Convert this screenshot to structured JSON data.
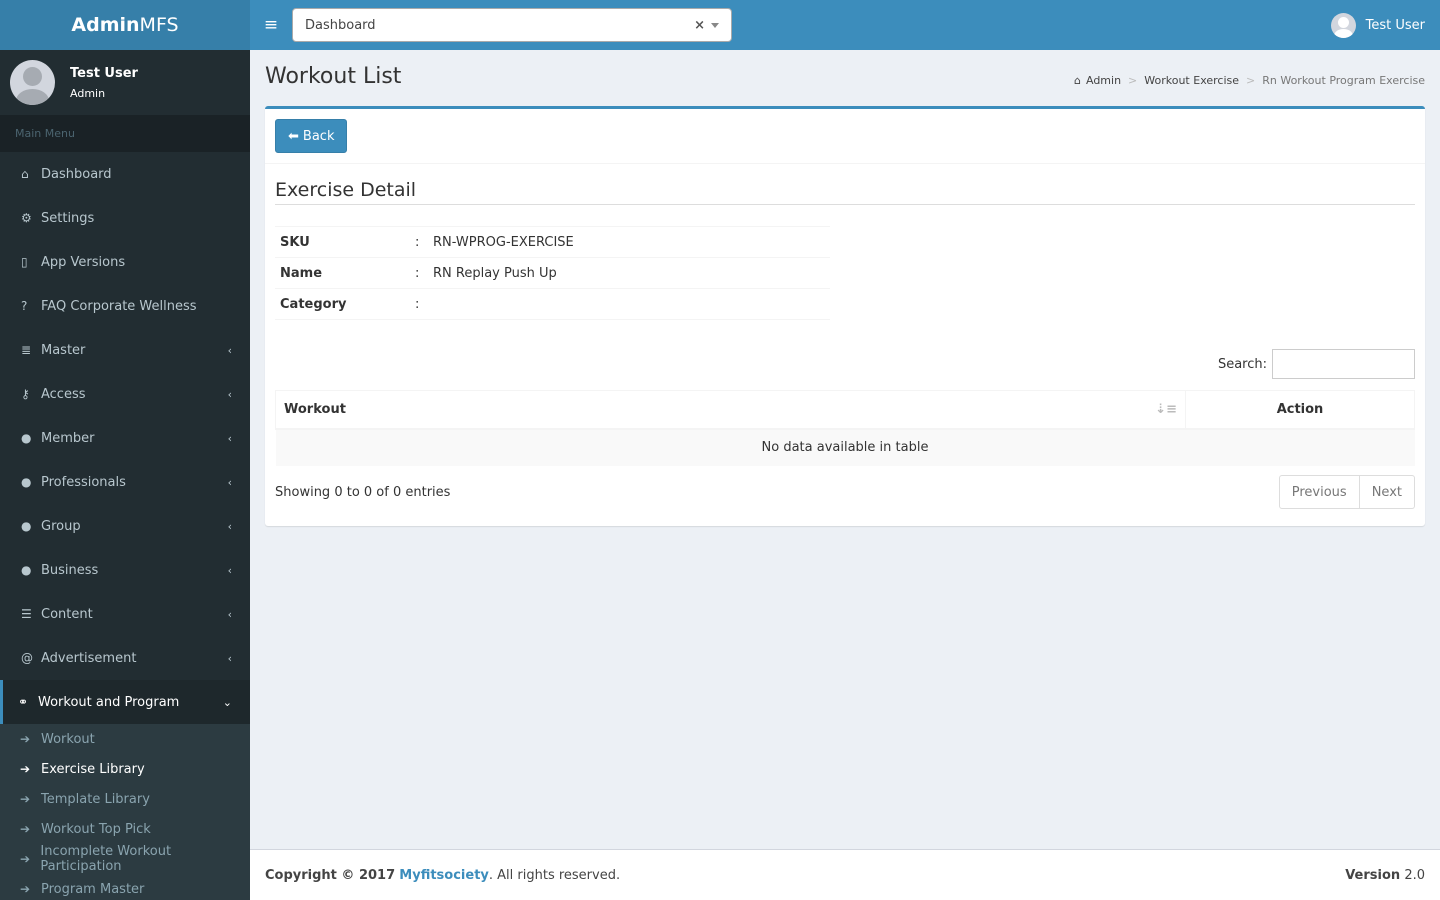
{
  "app": {
    "logo_bold": "Admin",
    "logo_light": "MFS"
  },
  "topbar": {
    "menu_icon": "≡",
    "select_value": "Dashboard",
    "select_clear": "×",
    "user_name": "Test User"
  },
  "sidebar": {
    "user": {
      "name": "Test User",
      "role": "Admin"
    },
    "menu_header": "Main Menu",
    "items": [
      {
        "label": "Dashboard",
        "icon": "home-icon"
      },
      {
        "label": "Settings",
        "icon": "cogs-icon"
      },
      {
        "label": "App Versions",
        "icon": "mobile-icon"
      },
      {
        "label": "FAQ Corporate Wellness",
        "icon": "question-icon"
      },
      {
        "label": "Master",
        "icon": "database-icon"
      },
      {
        "label": "Access",
        "icon": "key-icon"
      },
      {
        "label": "Member",
        "icon": "user-icon"
      },
      {
        "label": "Professionals",
        "icon": "user-icon"
      },
      {
        "label": "Group",
        "icon": "users-icon"
      },
      {
        "label": "Business",
        "icon": "user-icon"
      },
      {
        "label": "Content",
        "icon": "list-icon"
      },
      {
        "label": "Advertisement",
        "icon": "at-icon"
      },
      {
        "label": "Workout and Program",
        "icon": "bicycle-icon"
      }
    ],
    "submenu": [
      {
        "label": "Workout"
      },
      {
        "label": "Exercise Library"
      },
      {
        "label": "Template Library"
      },
      {
        "label": "Workout Top Pick"
      },
      {
        "label": "Incomplete Workout Participation"
      },
      {
        "label": "Program Master"
      }
    ]
  },
  "header": {
    "title": "Workout List",
    "breadcrumb": [
      "Admin",
      "Workout Exercise",
      "Rn Workout Program Exercise"
    ]
  },
  "box": {
    "back_label": "Back",
    "section_title": "Exercise Detail",
    "details": [
      {
        "key": "SKU",
        "value": "RN-WPROG-EXERCISE"
      },
      {
        "key": "Name",
        "value": "RN Replay Push Up"
      },
      {
        "key": "Category",
        "value": ""
      }
    ],
    "search_label": "Search:",
    "columns": [
      "Workout",
      "Action"
    ],
    "empty_text": "No data available in table",
    "info_text": "Showing 0 to 0 of 0 entries",
    "pager": {
      "prev": "Previous",
      "next": "Next"
    }
  },
  "footer": {
    "copyright_prefix": "Copyright © 2017",
    "brand": "Myfitsociety",
    "copyright_suffix": ". All rights reserved.",
    "version_label": "Version",
    "version_value": "2.0"
  },
  "colors": {
    "primary": "#3c8dbc",
    "primary_dark": "#367fa9",
    "sidebar": "#222d32",
    "content_bg": "#ecf0f5"
  }
}
